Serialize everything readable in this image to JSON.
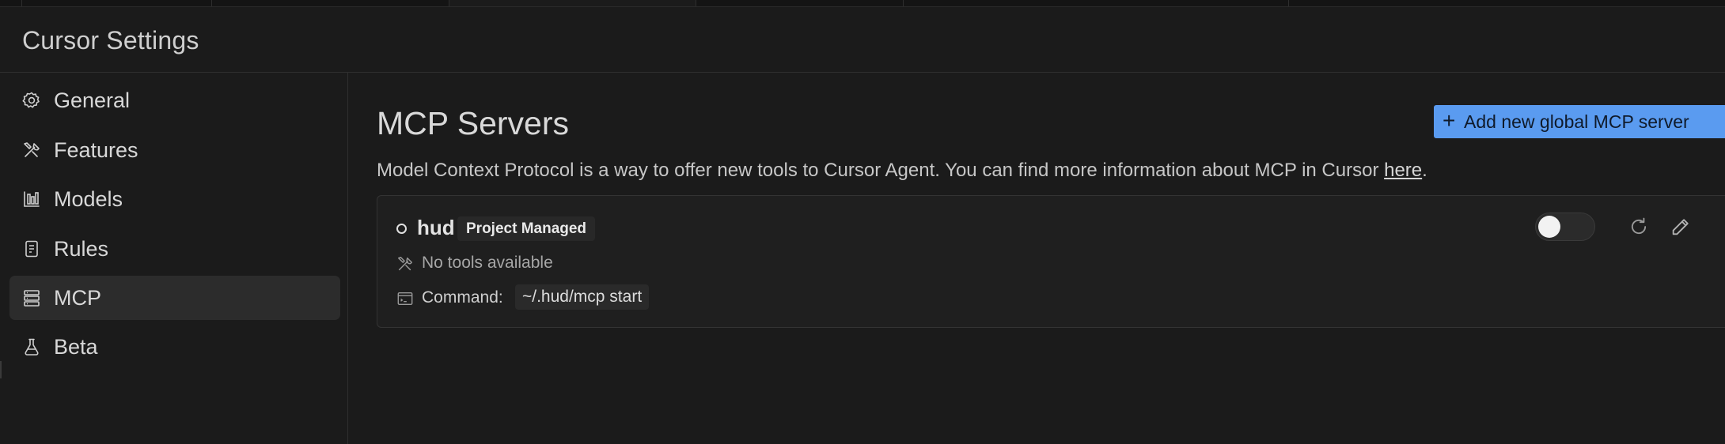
{
  "window": {
    "title": "Cursor Settings"
  },
  "sidebar": {
    "items": [
      {
        "label": "General",
        "icon": "gear-icon",
        "active": false
      },
      {
        "label": "Features",
        "icon": "tools-icon",
        "active": false
      },
      {
        "label": "Models",
        "icon": "bar-chart-icon",
        "active": false
      },
      {
        "label": "Rules",
        "icon": "document-icon",
        "active": false
      },
      {
        "label": "MCP",
        "icon": "server-icon",
        "active": true
      },
      {
        "label": "Beta",
        "icon": "flask-icon",
        "active": false
      }
    ]
  },
  "main": {
    "title": "MCP Servers",
    "add_button": {
      "plus": "+",
      "label": "Add new global MCP server"
    },
    "description_prefix": "Model Context Protocol is a way to offer new tools to Cursor Agent. You can find more information about MCP in Cursor ",
    "description_link": "here",
    "description_suffix": ".",
    "servers": [
      {
        "name": "hud",
        "badge": "Project Managed",
        "tools_text": "No tools available",
        "command_label": "Command:",
        "command_value": "~/.hud/mcp start",
        "enabled": false
      }
    ]
  },
  "colors": {
    "background": "#1b1b1b",
    "accent_button": "#5a9bf0",
    "active_nav": "#2c2c2c"
  }
}
